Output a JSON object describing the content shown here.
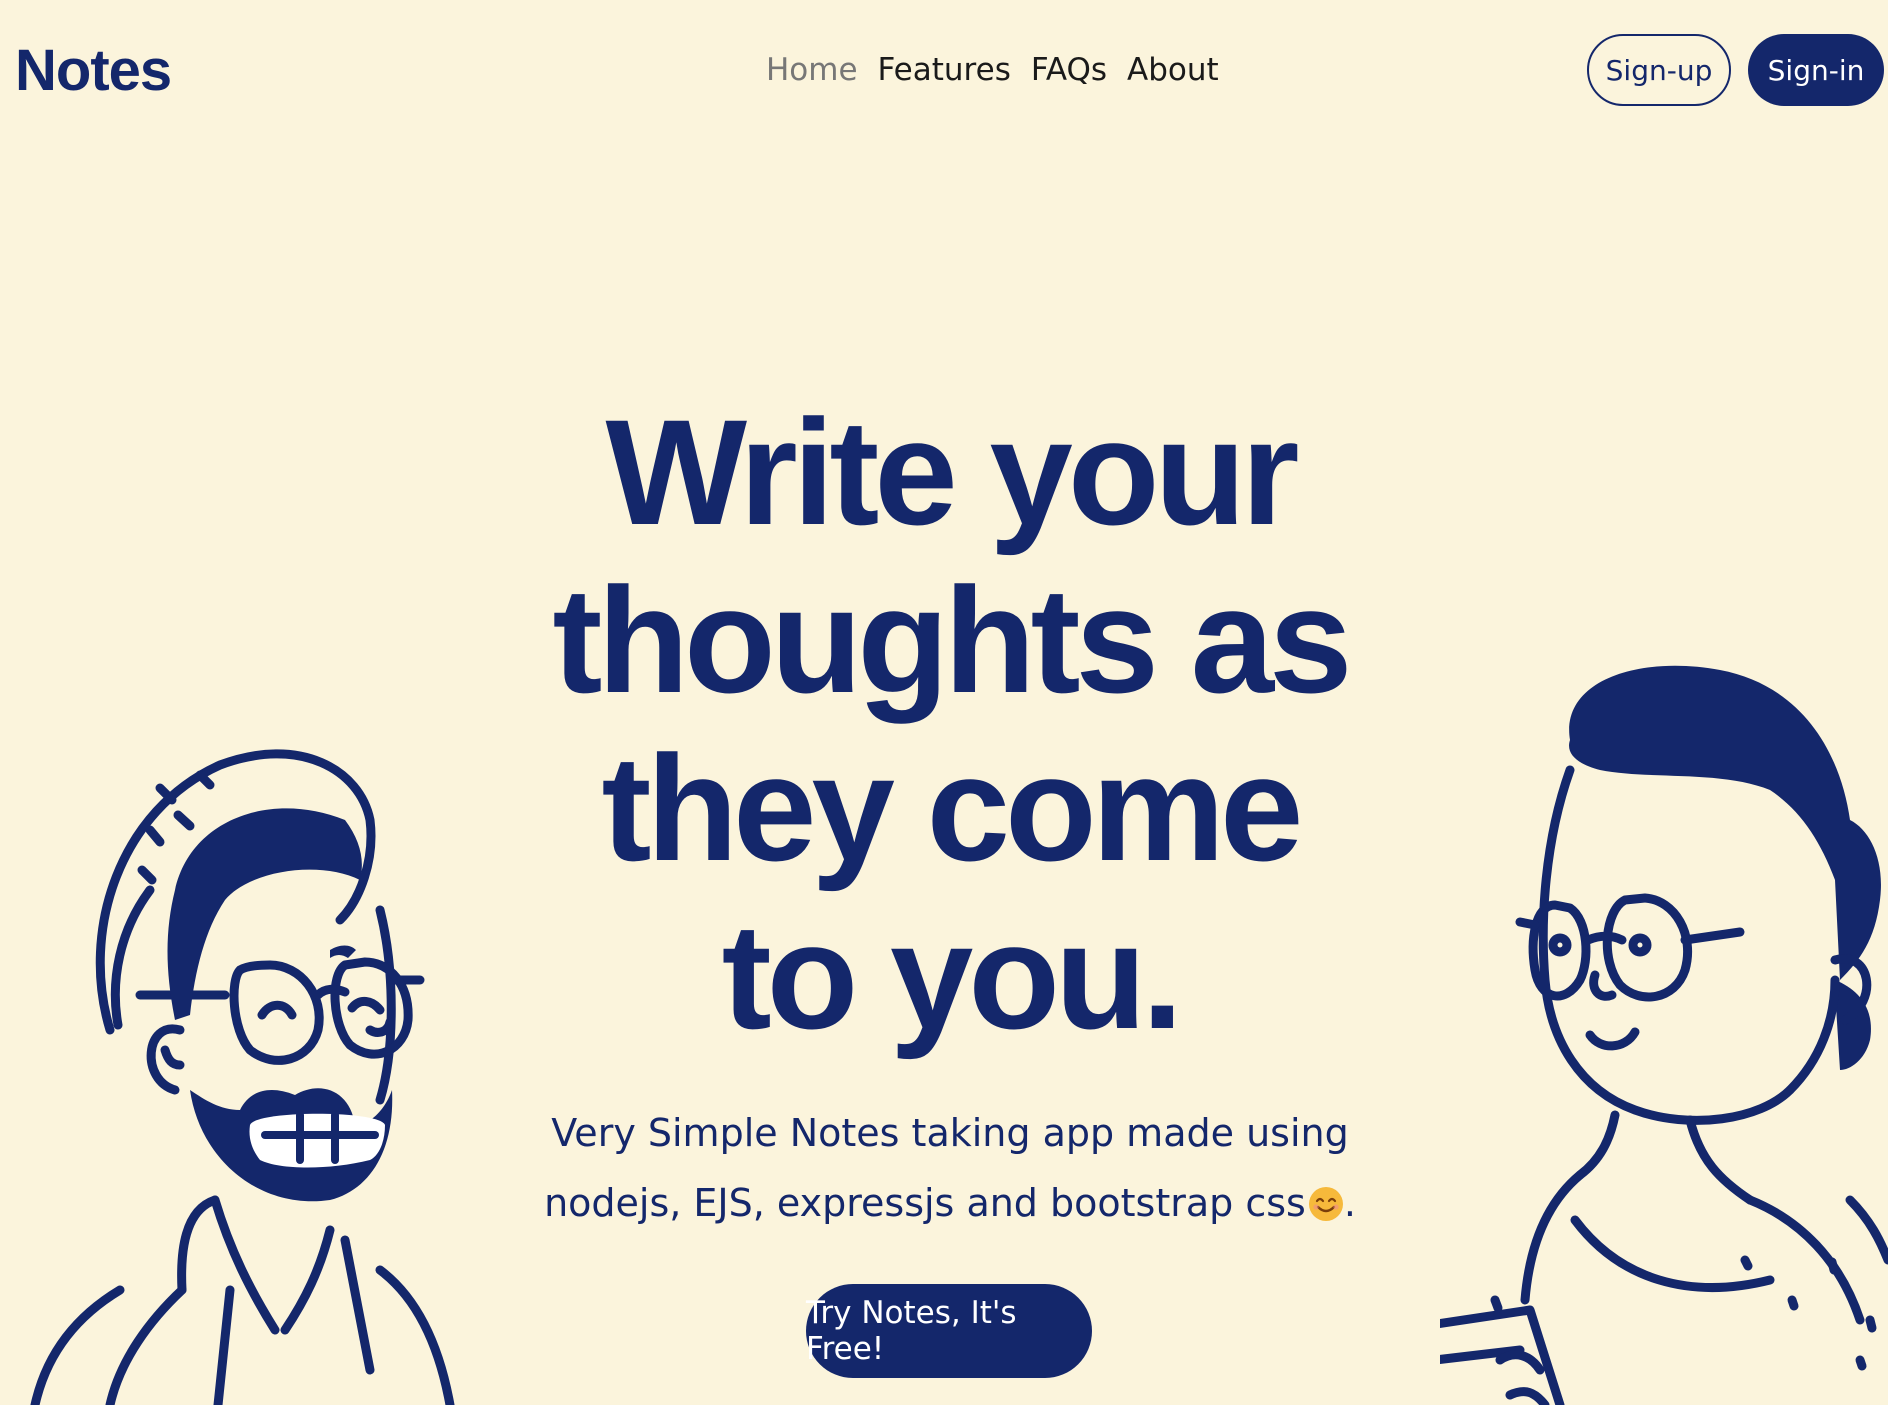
{
  "navbar": {
    "brand": "Notes",
    "links": [
      {
        "label": "Home",
        "active": true
      },
      {
        "label": "Features",
        "active": false
      },
      {
        "label": "FAQs",
        "active": false
      },
      {
        "label": "About",
        "active": false
      }
    ],
    "signup_label": "Sign-up",
    "signin_label": "Sign-in"
  },
  "hero": {
    "title": "Write your thoughts as they come to you.",
    "subtitle": "Very Simple Notes taking app made using nodejs, EJS, expressjs and bootstrap css",
    "subtitle_suffix": ".",
    "cta_label": "Try Notes, It's Free!"
  },
  "illustrations": {
    "left": "bearded-man-with-glasses",
    "right": "woman-with-glasses-holding-phone"
  },
  "colors": {
    "background": "#FBF4DC",
    "primary": "#14276B",
    "nav_text": "#1A1A1A",
    "nav_active": "#777777",
    "emoji": "#F6B93B"
  }
}
